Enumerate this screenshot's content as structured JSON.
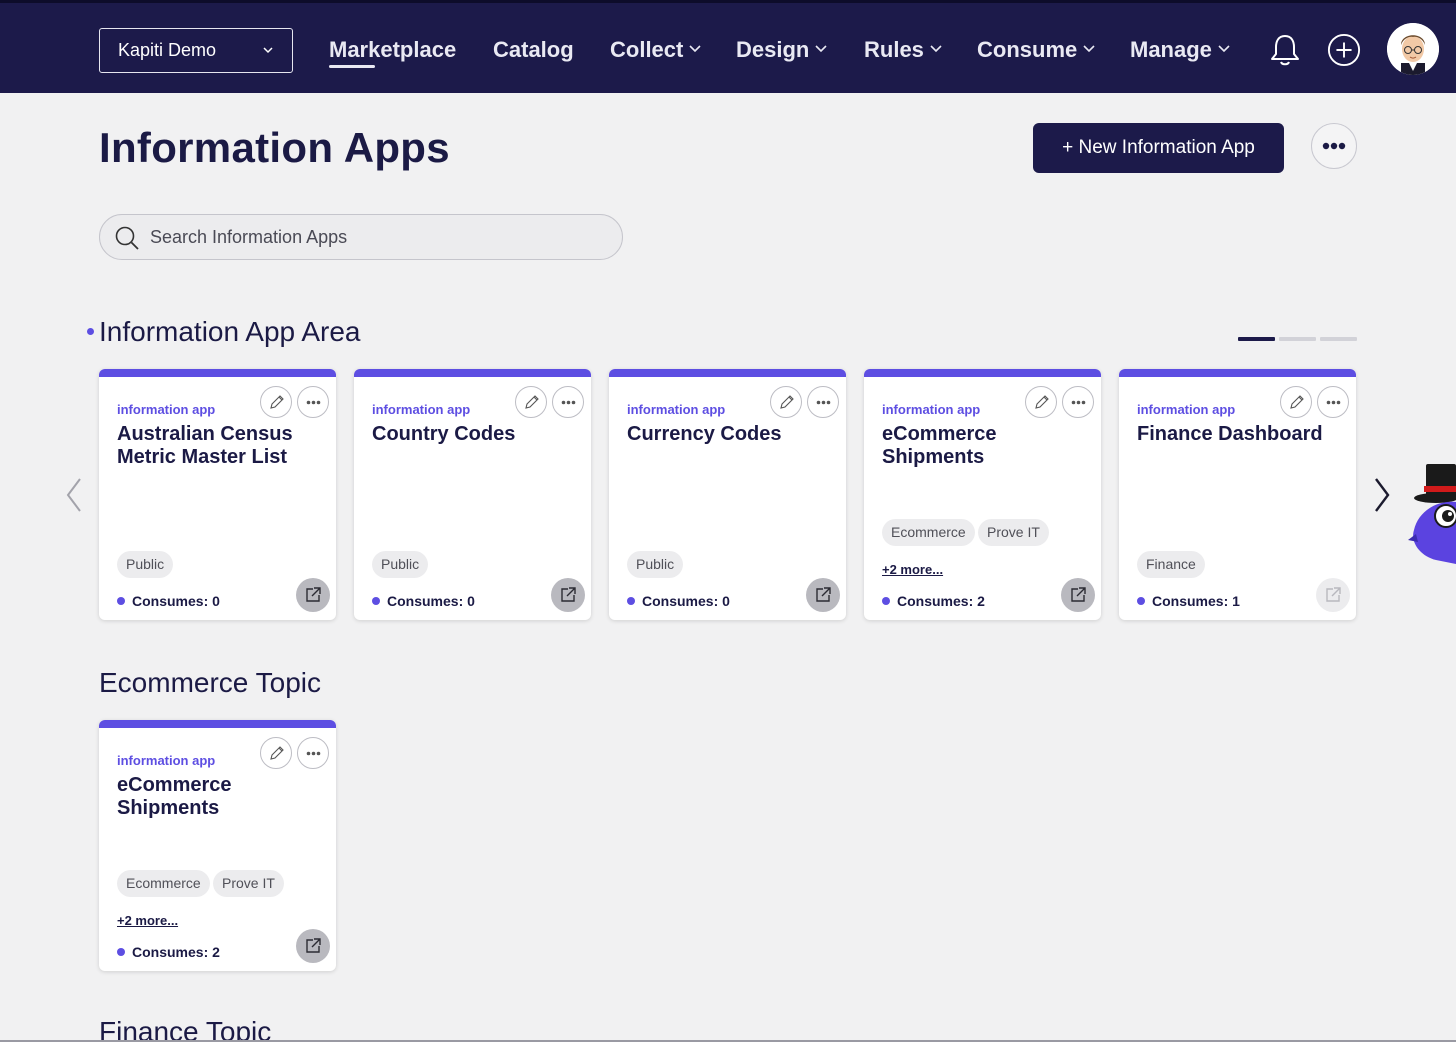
{
  "nav": {
    "workspace": "Kapiti Demo",
    "items": [
      "Marketplace",
      "Catalog",
      "Collect",
      "Design",
      "Rules",
      "Consume",
      "Manage"
    ]
  },
  "header": {
    "title": "Information Apps",
    "new_button": "+ New Information App",
    "search_placeholder": "Search Information Apps"
  },
  "sections": [
    {
      "title": "Information App Area",
      "cards": [
        {
          "type": "information app",
          "name": "Australian Census Metric Master List",
          "tags": [
            "Public"
          ],
          "more": "",
          "consumes": "Consumes: 0"
        },
        {
          "type": "information app",
          "name": "Country Codes",
          "tags": [
            "Public"
          ],
          "more": "",
          "consumes": "Consumes: 0"
        },
        {
          "type": "information app",
          "name": "Currency Codes",
          "tags": [
            "Public"
          ],
          "more": "",
          "consumes": "Consumes: 0"
        },
        {
          "type": "information app",
          "name": "eCommerce Shipments",
          "tags": [
            "Ecommerce",
            "Prove IT"
          ],
          "more": "+2 more...",
          "consumes": "Consumes: 2"
        },
        {
          "type": "information app",
          "name": "Finance Dashboard",
          "tags": [
            "Finance"
          ],
          "more": "",
          "consumes": "Consumes: 1"
        }
      ]
    },
    {
      "title": "Ecommerce Topic",
      "cards": [
        {
          "type": "information app",
          "name": "eCommerce Shipments",
          "tags": [
            "Ecommerce",
            "Prove IT"
          ],
          "more": "+2 more...",
          "consumes": "Consumes: 2"
        }
      ]
    },
    {
      "title": "Finance Topic",
      "cards": []
    }
  ],
  "colors": {
    "nav_bg": "#1c1a4a",
    "accent": "#5d4ee2",
    "page_bg": "#f1f1f2"
  },
  "icons": [
    "chevron-down-icon",
    "bell-icon",
    "plus-circle-icon",
    "avatar",
    "search-icon",
    "pencil-icon",
    "ellipsis-icon",
    "external-link-icon",
    "chevron-left-icon",
    "chevron-right-icon"
  ]
}
